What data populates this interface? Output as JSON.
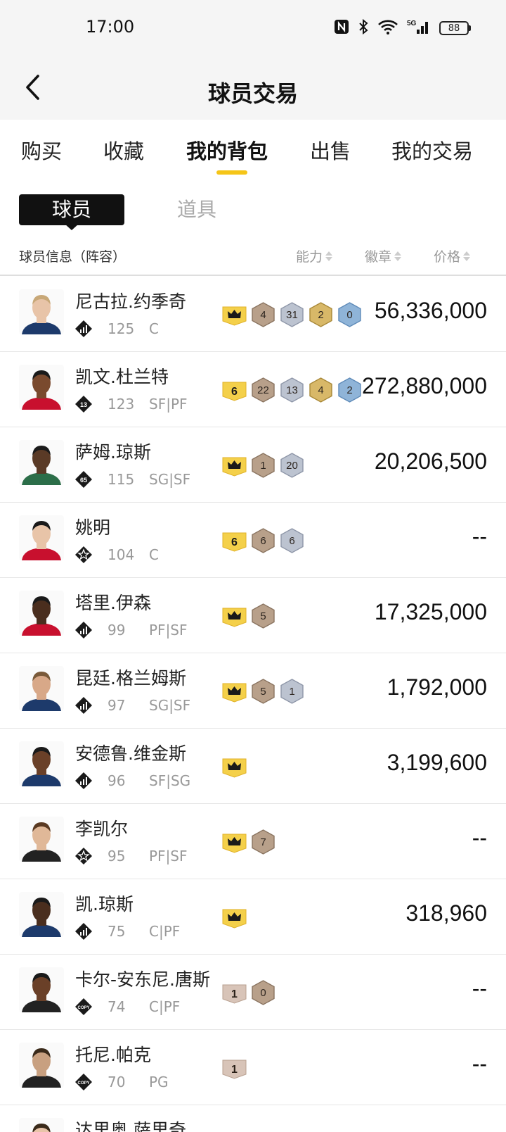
{
  "status_bar": {
    "time": "17:00",
    "battery": "88",
    "network": "5G",
    "icons": [
      "nfc-icon",
      "bluetooth-icon",
      "wifi-icon",
      "signal-icon",
      "battery-icon"
    ]
  },
  "nav": {
    "title": "球员交易",
    "back_icon": "chevron-left-icon"
  },
  "tabs": [
    {
      "label": "购买",
      "active": false
    },
    {
      "label": "收藏",
      "active": false
    },
    {
      "label": "我的背包",
      "active": true
    },
    {
      "label": "出售",
      "active": false
    },
    {
      "label": "我的交易",
      "active": false
    }
  ],
  "accent_color": "#f5c518",
  "subtabs": {
    "players": "球员",
    "props": "道具"
  },
  "list_header": {
    "info": "球员信息（阵容）",
    "ability": "能力",
    "badges": "徽章",
    "price": "价格"
  },
  "players": [
    {
      "name": "尼古拉.约季奇",
      "tier": "chart",
      "rating": "125",
      "position": "C",
      "badges": [
        {
          "type": "crown",
          "value": ""
        },
        {
          "type": "bronze",
          "value": "4"
        },
        {
          "type": "silver",
          "value": "31"
        },
        {
          "type": "gold",
          "value": "2"
        },
        {
          "type": "blue",
          "value": "0"
        }
      ],
      "price": "56,336,000"
    },
    {
      "name": "凯文.杜兰特",
      "tier": "13",
      "rating": "123",
      "position": "SF|PF",
      "badges": [
        {
          "type": "num",
          "value": "6"
        },
        {
          "type": "bronze",
          "value": "22"
        },
        {
          "type": "silver",
          "value": "13"
        },
        {
          "type": "gold",
          "value": "4"
        },
        {
          "type": "blue",
          "value": "2"
        }
      ],
      "price": "272,880,000"
    },
    {
      "name": "萨姆.琼斯",
      "tier": "65",
      "rating": "115",
      "position": "SG|SF",
      "badges": [
        {
          "type": "crown",
          "value": ""
        },
        {
          "type": "bronze",
          "value": "1"
        },
        {
          "type": "silver",
          "value": "20"
        }
      ],
      "price": "20,206,500"
    },
    {
      "name": "姚明",
      "tier": "star",
      "rating": "104",
      "position": "C",
      "badges": [
        {
          "type": "num",
          "value": "6"
        },
        {
          "type": "bronze",
          "value": "6"
        },
        {
          "type": "silver",
          "value": "6"
        }
      ],
      "price": "--"
    },
    {
      "name": "塔里.伊森",
      "tier": "chart",
      "rating": "99",
      "position": "PF|SF",
      "badges": [
        {
          "type": "crown",
          "value": ""
        },
        {
          "type": "bronze",
          "value": "5"
        }
      ],
      "price": "17,325,000"
    },
    {
      "name": "昆廷.格兰姆斯",
      "tier": "chart",
      "rating": "97",
      "position": "SG|SF",
      "badges": [
        {
          "type": "crown",
          "value": ""
        },
        {
          "type": "bronze",
          "value": "5"
        },
        {
          "type": "silver",
          "value": "1"
        }
      ],
      "price": "1,792,000"
    },
    {
      "name": "安德鲁.维金斯",
      "tier": "chart",
      "rating": "96",
      "position": "SF|SG",
      "badges": [
        {
          "type": "crown",
          "value": ""
        }
      ],
      "price": "3,199,600"
    },
    {
      "name": "李凯尔",
      "tier": "star",
      "rating": "95",
      "position": "PF|SF",
      "badges": [
        {
          "type": "crown",
          "value": ""
        },
        {
          "type": "bronze",
          "value": "7"
        }
      ],
      "price": "--"
    },
    {
      "name": "凯.琼斯",
      "tier": "chart",
      "rating": "75",
      "position": "C|PF",
      "badges": [
        {
          "type": "crown",
          "value": ""
        }
      ],
      "price": "318,960"
    },
    {
      "name": "卡尔-安东尼.唐斯",
      "tier": "copy",
      "rating": "74",
      "position": "C|PF",
      "badges": [
        {
          "type": "lvl",
          "value": "1"
        },
        {
          "type": "bronze",
          "value": "0"
        }
      ],
      "price": "--"
    },
    {
      "name": "托尼.帕克",
      "tier": "copy",
      "rating": "70",
      "position": "PG",
      "badges": [
        {
          "type": "lvl",
          "value": "1"
        }
      ],
      "price": "--"
    },
    {
      "name": "达里奥.萨里奇",
      "tier": "chart",
      "rating": "",
      "position": "",
      "badges": [],
      "price": ""
    }
  ]
}
